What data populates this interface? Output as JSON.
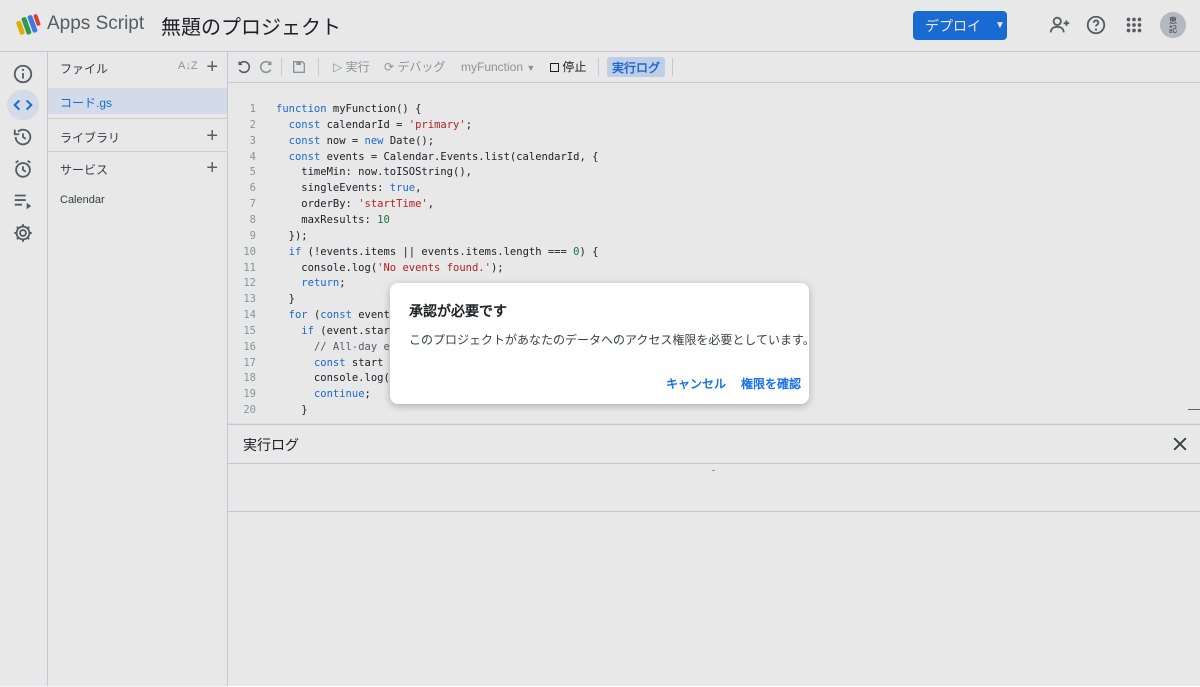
{
  "header": {
    "app_name": "Apps Script",
    "project_title": "無題のプロジェクト",
    "deploy_label": "デプロイ",
    "avatar_text": "恵\n記"
  },
  "files_panel": {
    "files_label": "ファイル",
    "file_name": "コード.gs",
    "libraries_label": "ライブラリ",
    "services_label": "サービス",
    "service_item": "Calendar"
  },
  "toolbar": {
    "run_label": "▷ 実行",
    "debug_label": "デバッグ",
    "function_select": "myFunction",
    "stop_label": "停止",
    "exec_log_label": "実行ログ"
  },
  "code": [
    {
      "n": "1",
      "t": "function myFunction() {"
    },
    {
      "n": "2",
      "t": "  const calendarId = 'primary';"
    },
    {
      "n": "3",
      "t": "  const now = new Date();"
    },
    {
      "n": "4",
      "t": "  const events = Calendar.Events.list(calendarId, {"
    },
    {
      "n": "5",
      "t": "    timeMin: now.toISOString(),"
    },
    {
      "n": "6",
      "t": "    singleEvents: true,"
    },
    {
      "n": "7",
      "t": "    orderBy: 'startTime',"
    },
    {
      "n": "8",
      "t": "    maxResults: 10"
    },
    {
      "n": "9",
      "t": "  });"
    },
    {
      "n": "10",
      "t": "  if (!events.items || events.items.length === 0) {"
    },
    {
      "n": "11",
      "t": "    console.log('No events found.');"
    },
    {
      "n": "12",
      "t": "    return;"
    },
    {
      "n": "13",
      "t": "  }"
    },
    {
      "n": "14",
      "t": "  for (const event"
    },
    {
      "n": "15",
      "t": "    if (event.start"
    },
    {
      "n": "16",
      "t": "      // All-day e"
    },
    {
      "n": "17",
      "t": "      const start"
    },
    {
      "n": "18",
      "t": "      console.log("
    },
    {
      "n": "19",
      "t": "      continue;"
    },
    {
      "n": "20",
      "t": "    }"
    }
  ],
  "log_panel": {
    "title": "実行ログ"
  },
  "dialog": {
    "title": "承認が必要です",
    "message": "このプロジェクトがあなたのデータへのアクセス権限を必要としています。",
    "cancel_label": "キャンセル",
    "review_label": "権限を確認"
  },
  "colors": {
    "accent": "#1a73e8",
    "header_bg": "#ffffff",
    "page_bg": "#f1f3f4"
  }
}
